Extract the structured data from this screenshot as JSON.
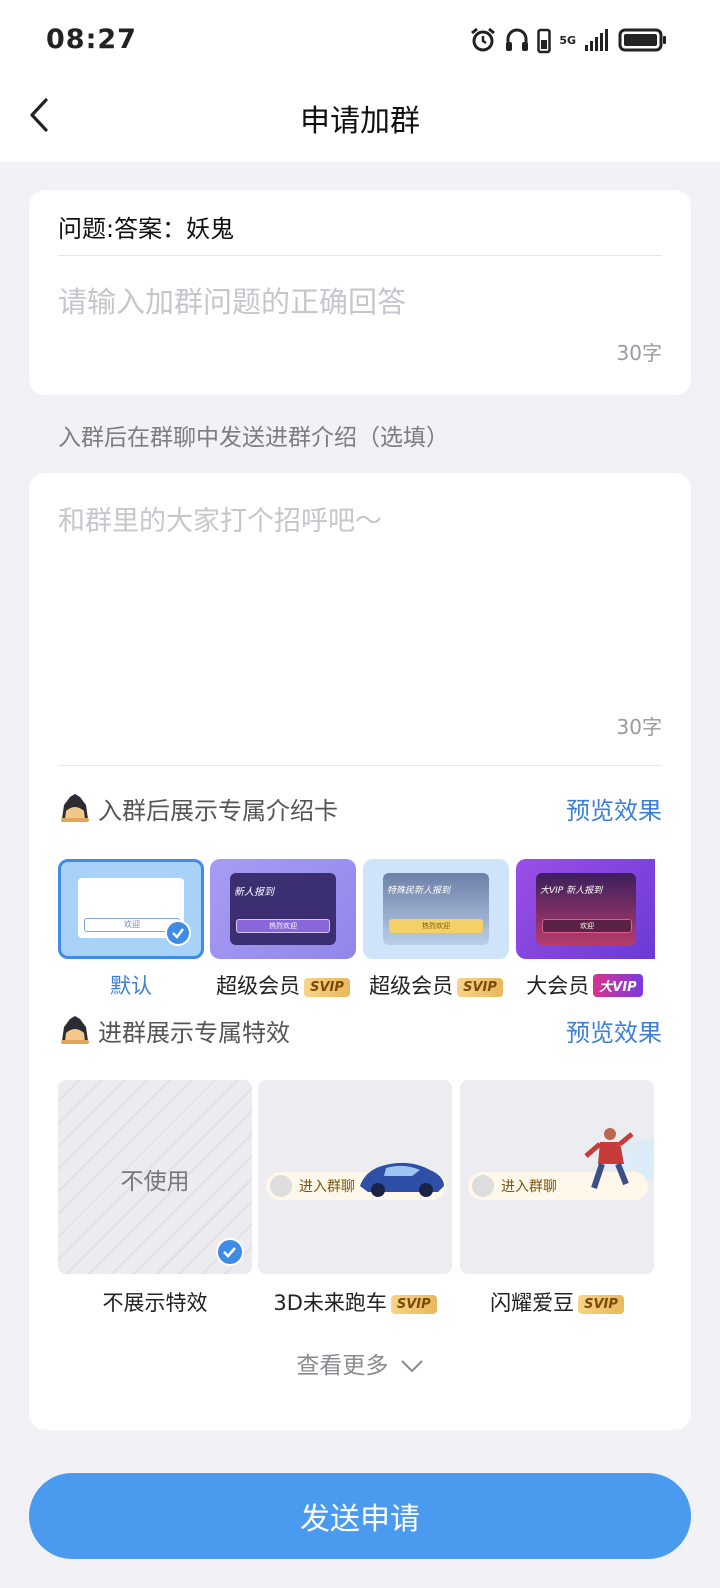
{
  "status": {
    "time": "08:27",
    "network": "5G"
  },
  "nav": {
    "title": "申请加群"
  },
  "question": {
    "text": "问题:答案：妖鬼",
    "placeholder": "请输入加群问题的正确回答",
    "counter": "30字"
  },
  "intro": {
    "section_label": "入群后在群聊中发送进群介绍（选填）",
    "placeholder": "和群里的大家打个招呼吧～",
    "counter": "30字"
  },
  "intro_cards": {
    "title": "入群后展示专属介绍卡",
    "preview": "预览效果",
    "items": [
      {
        "label": "默认",
        "badge": "",
        "selected": true
      },
      {
        "label": "超级会员",
        "badge": "SVIP",
        "banner": "新人报到",
        "button": "热烈欢迎"
      },
      {
        "label": "超级会员",
        "badge": "SVIP",
        "banner": "特殊民新人报到",
        "button": "热烈欢迎"
      },
      {
        "label": "大会员",
        "badge": "大VIP",
        "banner": "大VIP 新人报到",
        "button": "欢迎"
      }
    ],
    "default_button": "欢迎"
  },
  "effects": {
    "title": "进群展示专属特效",
    "preview": "预览效果",
    "items": [
      {
        "label": "不展示特效",
        "tile_text": "不使用",
        "badge": "",
        "selected": true
      },
      {
        "label": "3D未来跑车",
        "tile_text": "进入群聊",
        "badge": "SVIP"
      },
      {
        "label": "闪耀爱豆",
        "tile_text": "进入群聊",
        "badge": "SVIP"
      }
    ],
    "more": "查看更多"
  },
  "send_button": "发送申请",
  "colors": {
    "accent": "#4a9af0",
    "link": "#3d7fd6",
    "background": "#f1f1f6"
  }
}
